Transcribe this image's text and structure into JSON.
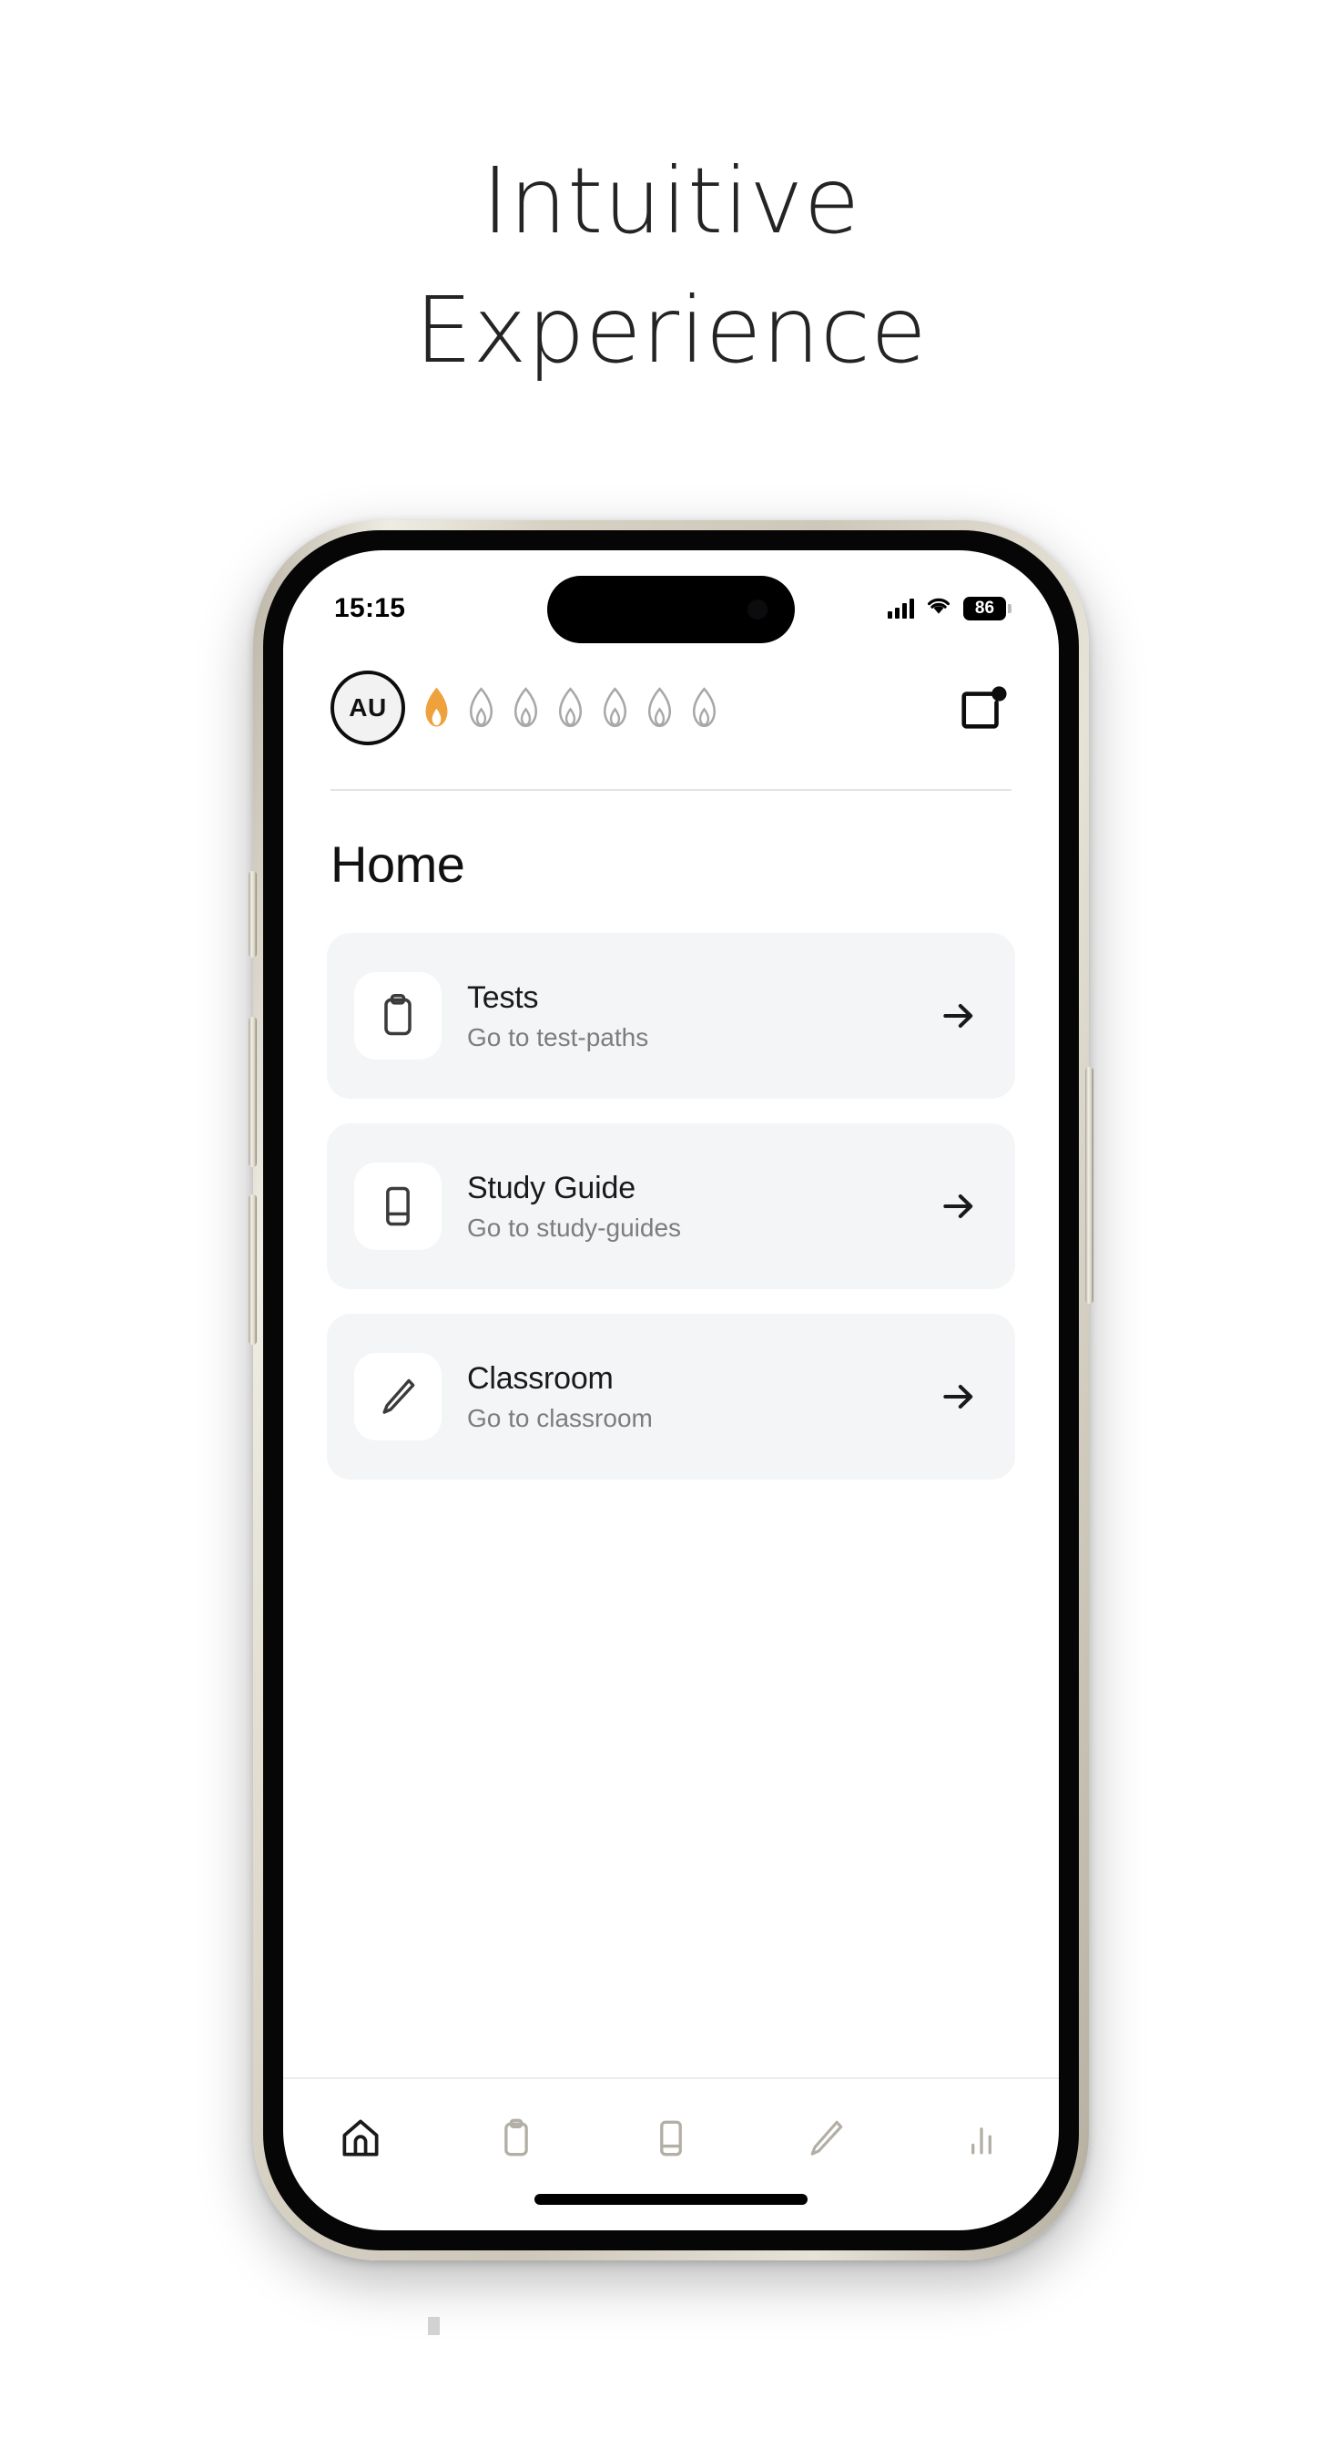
{
  "headline": {
    "line1": "Intuitive",
    "line2": "Experience"
  },
  "colors": {
    "flame_active": "#EFA13C",
    "flame_inactive": "#A8A8A8",
    "card_bg": "#F4F5F6",
    "text_primary": "#1A1A1A",
    "text_secondary": "#7D7D7D",
    "tab_active": "#1A1A1A",
    "tab_inactive": "#B3AFA6"
  },
  "status_bar": {
    "time": "15:15",
    "signal_icon": "cellular-signal-icon",
    "wifi_icon": "wifi-icon",
    "battery_level": "86",
    "battery_icon": "battery-icon"
  },
  "app_header": {
    "avatar": {
      "initials": "AU",
      "icon": "avatar"
    },
    "streak": {
      "total": 7,
      "active": 1,
      "icon": "flame-icon",
      "items": [
        {
          "state": "active"
        },
        {
          "state": "inactive"
        },
        {
          "state": "inactive"
        },
        {
          "state": "inactive"
        },
        {
          "state": "inactive"
        },
        {
          "state": "inactive"
        },
        {
          "state": "inactive"
        }
      ]
    },
    "notification": {
      "icon": "notification-square-icon",
      "has_badge": true
    }
  },
  "main": {
    "page_title": "Home",
    "cards": [
      {
        "title": "Tests",
        "subtitle": "Go to test-paths",
        "icon": "clipboard-icon",
        "arrow_icon": "arrow-right-icon"
      },
      {
        "title": "Study Guide",
        "subtitle": "Go to study-guides",
        "icon": "book-icon",
        "arrow_icon": "arrow-right-icon"
      },
      {
        "title": "Classroom",
        "subtitle": "Go to classroom",
        "icon": "pencil-icon",
        "arrow_icon": "arrow-right-icon"
      }
    ]
  },
  "tabbar": {
    "items": [
      {
        "name": "home",
        "icon": "home-icon",
        "active": true
      },
      {
        "name": "tests",
        "icon": "clipboard-icon",
        "active": false
      },
      {
        "name": "study-guide",
        "icon": "book-icon",
        "active": false
      },
      {
        "name": "classroom",
        "icon": "pencil-icon",
        "active": false
      },
      {
        "name": "stats",
        "icon": "bar-chart-icon",
        "active": false
      }
    ]
  }
}
